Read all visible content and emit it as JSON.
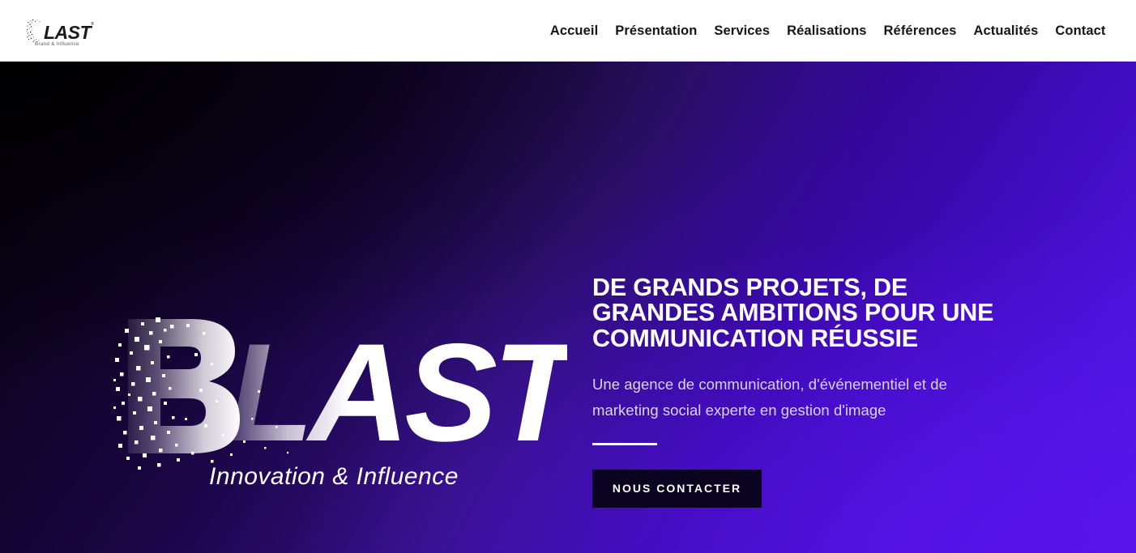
{
  "header": {
    "logo": {
      "wordmark": "BLAST",
      "dispersed_letter": "B",
      "solid_letters": "LAST",
      "registered_mark": "®",
      "tagline": "Brand & Influence",
      "icon_name": "blast-logo"
    },
    "nav": {
      "items": [
        {
          "label": "Accueil"
        },
        {
          "label": "Présentation"
        },
        {
          "label": "Services"
        },
        {
          "label": "Réalisations"
        },
        {
          "label": "Références"
        },
        {
          "label": "Actualités"
        },
        {
          "label": "Contact"
        }
      ]
    }
  },
  "hero": {
    "art": {
      "wordmark": "BLAST",
      "dispersed_letter": "B",
      "solid_letters": "LAST",
      "tagline": "Innovation & Influence"
    },
    "title": "DE GRANDS PROJETS, DE GRANDES AMBITIONS POUR UNE COMMUNICATION RÉUSSIE",
    "subtitle": "Une agence de communication, d'événementiel et de marketing social experte en gestion d'image",
    "cta_label": "NOUS CONTACTER"
  },
  "colors": {
    "header_bg": "#ffffff",
    "nav_text": "#15161a",
    "hero_gradient_start": "#05000a",
    "hero_gradient_mid": "#2c0780",
    "hero_gradient_end": "#4a10d6",
    "title_text": "#ffffff",
    "subtitle_text": "#d9d5ef",
    "rule": "#ffffff",
    "cta_bg": "#0a0420",
    "cta_text": "#ffffff"
  }
}
